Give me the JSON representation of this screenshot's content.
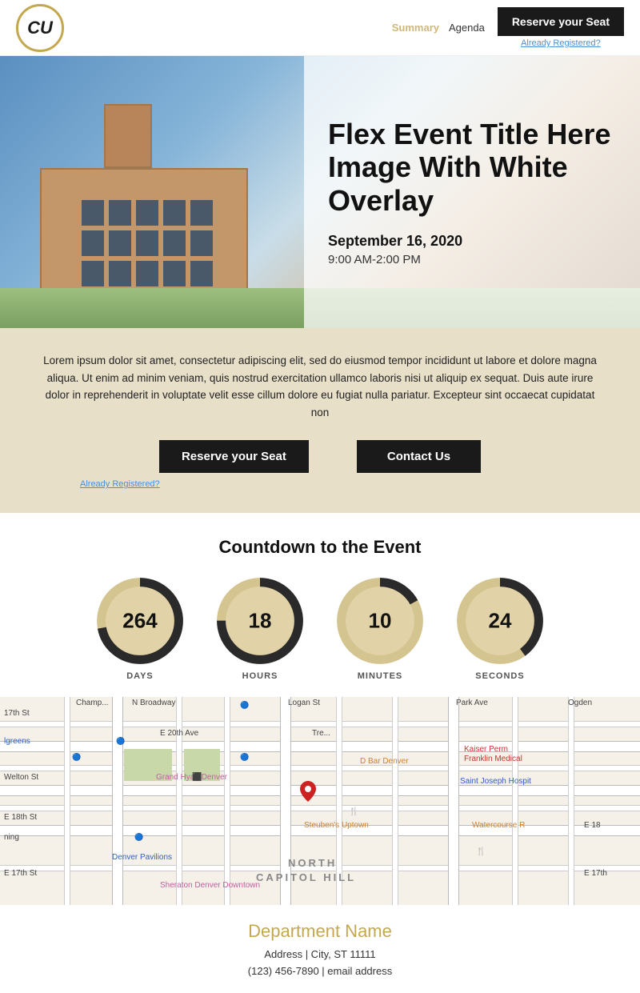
{
  "header": {
    "logo_text": "CU",
    "nav": {
      "summary_label": "Summary",
      "agenda_label": "Agenda"
    },
    "reserve_btn": "Reserve your Seat",
    "already_registered": "Already Registered?"
  },
  "hero": {
    "title": "Flex Event Title Here Image With White Overlay",
    "date": "September 16, 2020",
    "time": "9:00 AM-2:00 PM"
  },
  "description": {
    "text": "Lorem ipsum dolor sit amet, consectetur adipiscing elit, sed do eiusmod tempor incididunt ut labore et dolore magna aliqua. Ut enim ad minim veniam, quis nostrud exercitation ullamco laboris nisi ut aliquip ex sequat. Duis aute irure dolor in reprehenderit in voluptate velit esse cillum dolore eu fugiat nulla pariatur. Excepteur sint occaecat cupidatat non",
    "reserve_btn": "Reserve your Seat",
    "contact_btn": "Contact Us",
    "already_registered": "Already Registered?"
  },
  "countdown": {
    "title": "Countdown to the Event",
    "items": [
      {
        "value": "264",
        "label": "DAYS",
        "pct": 72
      },
      {
        "value": "18",
        "label": "HOURS",
        "pct": 75
      },
      {
        "value": "10",
        "label": "MINUTES",
        "pct": 17
      },
      {
        "value": "24",
        "label": "SECONDS",
        "pct": 40
      }
    ]
  },
  "location": {
    "dept_name": "Department Name",
    "address": "Address | City, ST 11111",
    "contact": "(123) 456-7890  |  email address"
  },
  "colors": {
    "gold": "#CFB87C",
    "dark": "#1a1a1a",
    "tan": "#e8dfc8",
    "circle_fill": "#c4a84f"
  }
}
